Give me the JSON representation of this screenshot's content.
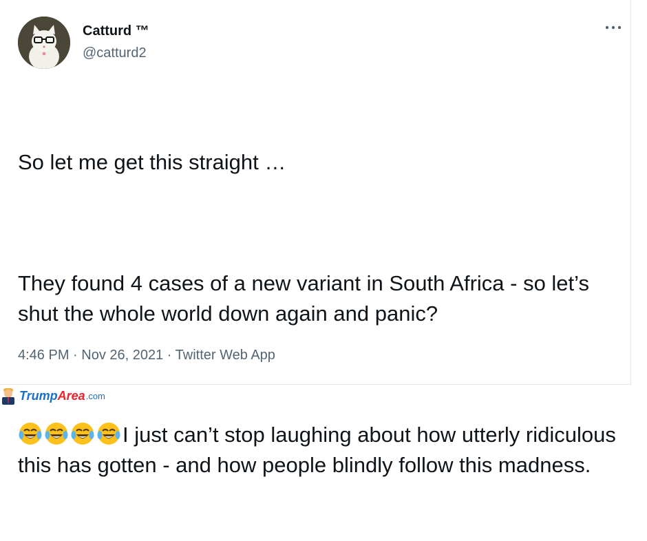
{
  "tweet": {
    "display_name": "Catturd ™",
    "handle": "@catturd2",
    "paragraphs": [
      "So let me get this straight …",
      "They found 4 cases of a new variant in South Africa - so let’s shut the whole world down again and panic?",
      "I just can’t stop laughing about how utterly ridiculous this has gotten - and how people blindly follow this madness."
    ],
    "emojis": [
      "face-with-tears-of-joy-icon",
      "face-with-tears-of-joy-icon",
      "face-with-tears-of-joy-icon",
      "face-with-tears-of-joy-icon"
    ],
    "time": "4:46 PM",
    "separator": " · ",
    "date": "Nov 26, 2021",
    "source": "Twitter Web App"
  },
  "watermark": {
    "brand_main": "Trump",
    "brand_accent": "Area",
    "suffix": ".com"
  },
  "colors": {
    "text": "#0f1419",
    "muted": "#536471",
    "watermark_blue": "#1a6fc7",
    "watermark_red": "#e8242b"
  }
}
